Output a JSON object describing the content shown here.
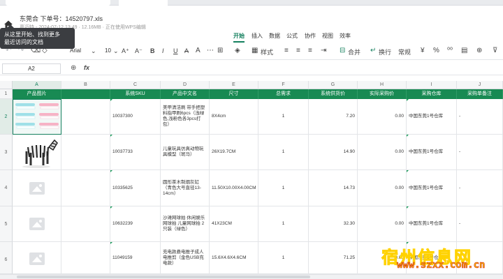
{
  "titlebar": {
    "filename": "东莞合 下单号：14520797.xls",
    "meta": "嘉迈特 - 2024-07-12 13:49 · 12.16MB · 正在使用WPS编辑"
  },
  "tooltip": {
    "line1": "从这里开始、找到更多",
    "line2": "最近访问的文档"
  },
  "menu": [
    "开始",
    "插入",
    "数据",
    "公式",
    "协作",
    "视图",
    "效率"
  ],
  "toolbar": {
    "font": "Arial",
    "size": "10",
    "style_label": "样式",
    "merge_label": "合并",
    "wrap_label": "换行",
    "format_label": "常规"
  },
  "formula": {
    "cell_ref": "A2",
    "fx": "fx"
  },
  "columns": [
    "A",
    "B",
    "C",
    "D",
    "E",
    "F",
    "G",
    "H",
    "I",
    "J"
  ],
  "headers": [
    "产品图片",
    "",
    "系统SKU",
    "产品中文名",
    "尺寸",
    "总需求",
    "系统供货价",
    "实际采购价",
    "采购仓库",
    "采购单备注"
  ],
  "rows": [
    {
      "num": "1"
    },
    {
      "num": "2",
      "sku": "10037300",
      "name": "美甲清洁刷 带手把塑料指甲刷6pcs（浅绿色,浅粉色各3pcs打包）",
      "size": "8X4cm",
      "qty": "1",
      "supply": "7.20",
      "actual": "0.00",
      "wh": "中国东莞1号仓库",
      "note": "-"
    },
    {
      "num": "3",
      "sku": "10037733",
      "name": "儿童玩具仿真动物玩具模型（斑马）",
      "size": "26X19.7CM",
      "qty": "1",
      "supply": "14.90",
      "actual": "0.00",
      "wh": "中国东莞1号仓库",
      "note": "-"
    },
    {
      "num": "4",
      "sku": "10335625",
      "name": "圆形茶木制烟灰缸（青色大号直径13-14cm）",
      "size": "11.50X10.00X4.00CM",
      "qty": "1",
      "supply": "14.73",
      "actual": "0.00",
      "wh": "中国东莞1号仓库",
      "note": "-"
    },
    {
      "num": "5",
      "sku": "10632239",
      "name": "沙滩网球拍 休闲娱乐网球拍 儿童网球拍 2只装（绿色）",
      "size": "41X23CM",
      "qty": "1",
      "supply": "32.30",
      "actual": "0.00",
      "wh": "中国东莞1号仓库",
      "note": "-"
    },
    {
      "num": "6",
      "sku": "11049159",
      "name": "充电款悬电推子成人电推剪（金色USB充电款）",
      "size": "15.6X4.6X4.6CM",
      "qty": "1",
      "supply": "71.25",
      "actual": "0.00",
      "wh": "中国东莞1号仓库",
      "note": "-"
    }
  ],
  "colors": {
    "accent": "#14805e",
    "header_fill": "#188a53"
  },
  "watermark": {
    "cn": "宿州信息网",
    "url": "www.szxx.com.cn"
  }
}
